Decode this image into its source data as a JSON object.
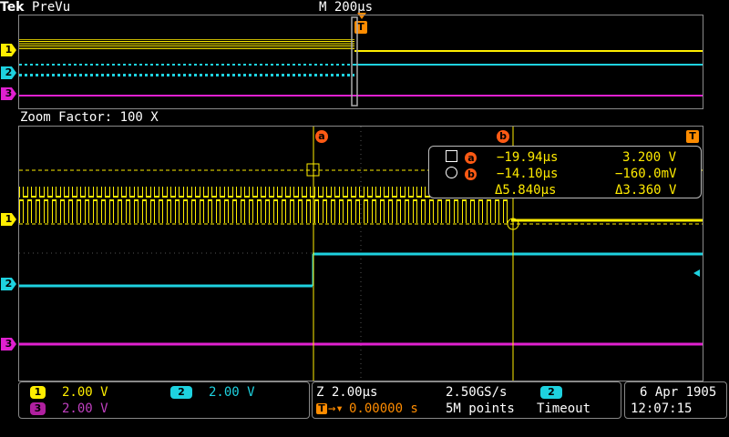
{
  "header": {
    "brand": "Tek",
    "mode": "PreVu",
    "timebase": "M 200µs"
  },
  "zoom_label": "Zoom Factor: 100 X",
  "channels": [
    {
      "num": "1",
      "color": "#ffee00",
      "scale": "2.00 V"
    },
    {
      "num": "2",
      "color": "#1ed2e0",
      "scale": "2.00 V"
    },
    {
      "num": "3",
      "color": "#e020d0",
      "scale": "2.00 V"
    }
  ],
  "markers": {
    "trigger": "T",
    "cursor_a": "a",
    "cursor_b": "b"
  },
  "measurements": {
    "a_time": "−19.94µs",
    "a_volt": "3.200 V",
    "b_time": "−14.10µs",
    "b_volt": "−160.0mV",
    "delta_time": "Δ5.840µs",
    "delta_volt": "Δ3.360 V"
  },
  "status": {
    "zoom_time": "Z 2.00µs",
    "sample_rate": "2.50GS/s",
    "trigger_source": "2",
    "trigger_mode": "Timeout",
    "trigger_pos": "0.00000 s",
    "record_length": "5M points",
    "date": "6 Apr  1905",
    "time": "12:07:15"
  }
}
